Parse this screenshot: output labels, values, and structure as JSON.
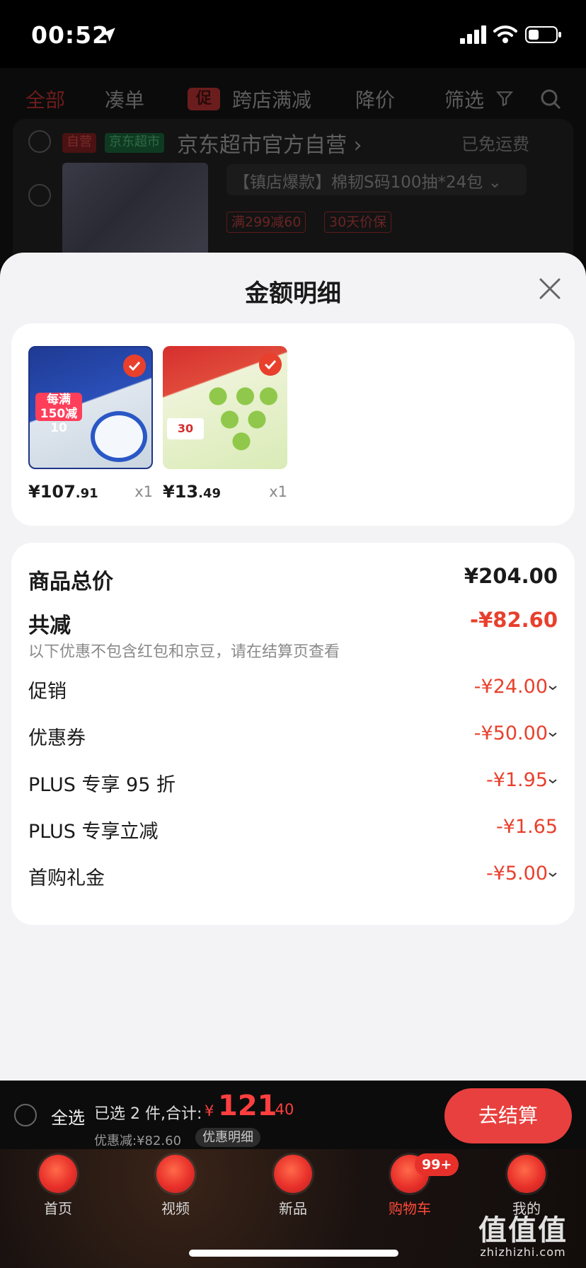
{
  "status_bar": {
    "time": "00:52"
  },
  "background": {
    "tabs": [
      "全部",
      "凑单",
      "跨店满减",
      "降价",
      "筛选"
    ],
    "promo_badge": "促",
    "store": {
      "self_badge": "自营",
      "jd_badge": "京东超市",
      "name": "京东超市官方自营 ›",
      "shipping": "已免运费"
    },
    "item": {
      "title": "【镇店爆款】棉韧S码100抽*24包 ⌄",
      "tags": [
        "满299减60",
        "30天价保"
      ]
    }
  },
  "sheet": {
    "title": "金额明细",
    "products": [
      {
        "price_int": "¥107",
        "price_dec": ".91",
        "qty": "x1",
        "img_text": "每满150减10"
      },
      {
        "price_int": "¥13",
        "price_dec": ".49",
        "qty": "x1",
        "img_text": "30"
      }
    ],
    "total": {
      "label": "商品总价",
      "value": "¥204.00"
    },
    "discount": {
      "label": "共减",
      "value": "-¥82.60",
      "note": "以下优惠不包含红包和京豆，请在结算页查看"
    },
    "items": [
      {
        "label": "促销",
        "value": "-¥24.00"
      },
      {
        "label": "优惠券",
        "value": "-¥50.00"
      },
      {
        "label": "PLUS 专享 95 折",
        "value": "-¥1.95"
      },
      {
        "label": "PLUS 专享立减",
        "value": "-¥1.65"
      },
      {
        "label": "首购礼金",
        "value": "-¥5.00"
      }
    ]
  },
  "checkout": {
    "select_all": "全选",
    "summary": "已选 2 件,合计:",
    "currency": "¥",
    "total_int": "121",
    "total_dec": ".40",
    "discount": "优惠减:¥82.60",
    "detail_button": "优惠明细",
    "checkout_button": "去结算"
  },
  "tab_bar": {
    "items": [
      {
        "label": "首页",
        "icon": "home-icon"
      },
      {
        "label": "视频",
        "icon": "video-icon"
      },
      {
        "label": "新品",
        "icon": "new-products-icon"
      },
      {
        "label": "购物车",
        "icon": "cart-icon",
        "active": true
      },
      {
        "label": "我的",
        "icon": "profile-icon"
      }
    ],
    "cart_badge": "99+"
  },
  "watermark": {
    "main": "值值值",
    "sub": "zhizhizhi.com"
  },
  "colors": {
    "accent": "#e8402d",
    "checkout": "#e8403e",
    "sheet_bg": "#f3f3f5"
  }
}
